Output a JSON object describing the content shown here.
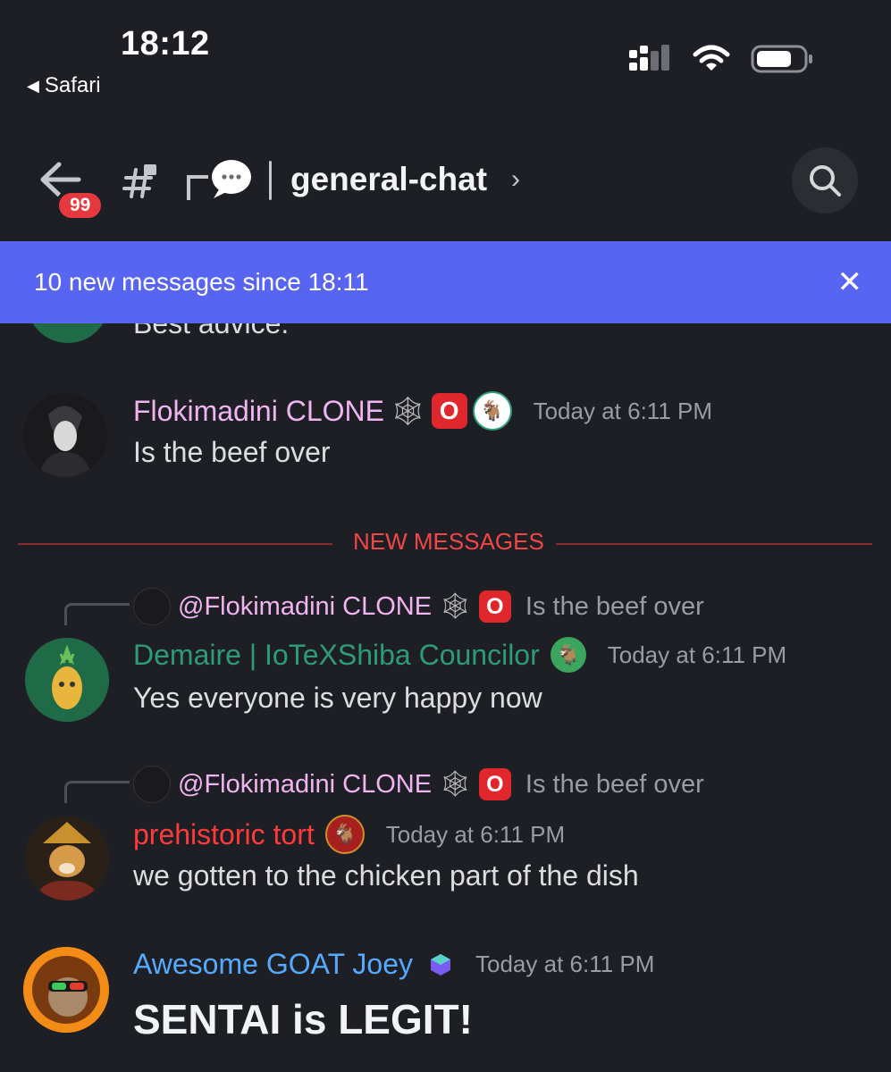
{
  "status_bar": {
    "time": "18:12",
    "back_app": "Safari"
  },
  "header": {
    "unread_badge": "99",
    "channel_name": "general-chat",
    "icons": [
      "back-arrow-icon",
      "channel-hash-lock-icon",
      "thread-icon",
      "chevron-right-icon",
      "search-icon"
    ]
  },
  "banner": {
    "text": "10 new messages since 18:11",
    "close": "✕",
    "color": "#5865f2"
  },
  "divider_label": "NEW MESSAGES",
  "partial_message": "Best advice.",
  "messages": [
    {
      "author": "Flokimadini CLONE",
      "author_color": "#f0b4f0",
      "time": "Today at 6:11 PM",
      "text": "Is the beef over"
    },
    {
      "reply_to": {
        "author": "@Flokimadini CLONE",
        "text": "Is the beef over"
      },
      "author": "Demaire | IoTeXShiba Councilor",
      "author_color": "#2e9b78",
      "time": "Today at 6:11 PM",
      "text": "Yes everyone is very happy now"
    },
    {
      "reply_to": {
        "author": "@Flokimadini CLONE",
        "text": "Is the beef over"
      },
      "author": "prehistoric tort",
      "author_color": "#ff3a3a",
      "time": "Today at 6:11 PM",
      "text": "we gotten to the chicken part of the dish"
    },
    {
      "author": "Awesome GOAT Joey",
      "author_color": "#55aaff",
      "time": "Today at 6:11 PM",
      "text": "SENTAI is LEGIT!"
    }
  ],
  "icon_badges": {
    "o_badge": "O"
  }
}
